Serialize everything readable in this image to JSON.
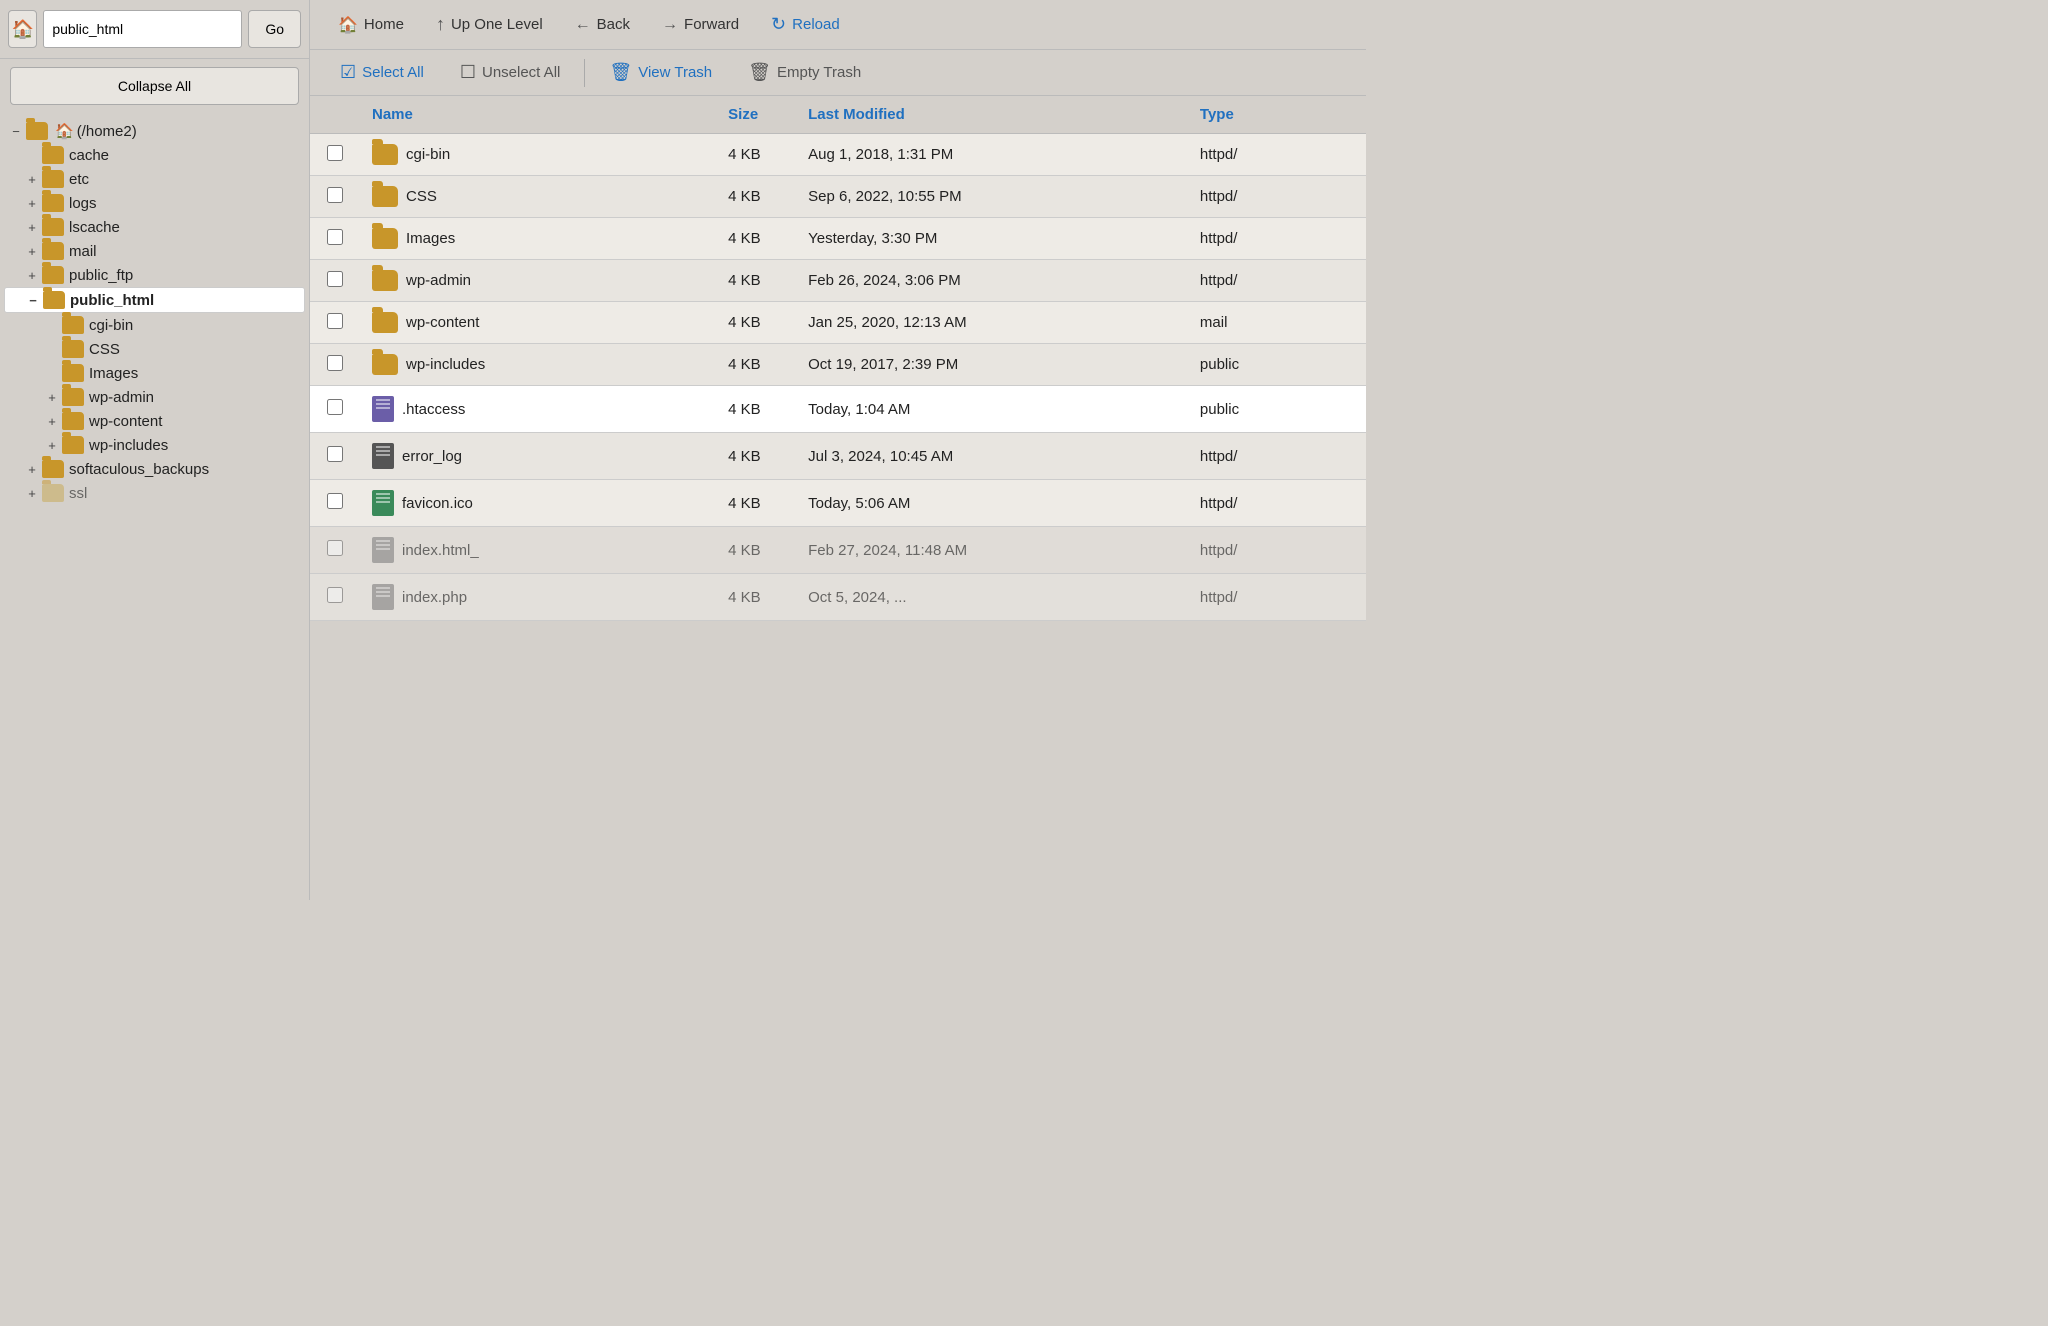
{
  "sidebar": {
    "path_value": "public_html",
    "go_label": "Go",
    "collapse_all_label": "Collapse All",
    "tree": [
      {
        "id": "home2",
        "label": "(/home2)",
        "indent": 0,
        "toggle": "−",
        "type": "home-folder",
        "selected": false
      },
      {
        "id": "cache",
        "label": "cache",
        "indent": 1,
        "toggle": "",
        "type": "folder",
        "selected": false
      },
      {
        "id": "etc",
        "label": "etc",
        "indent": 1,
        "toggle": "+",
        "type": "folder",
        "selected": false
      },
      {
        "id": "logs",
        "label": "logs",
        "indent": 1,
        "toggle": "+",
        "type": "folder",
        "selected": false
      },
      {
        "id": "lscache",
        "label": "lscache",
        "indent": 1,
        "toggle": "+",
        "type": "folder",
        "selected": false
      },
      {
        "id": "mail",
        "label": "mail",
        "indent": 1,
        "toggle": "+",
        "type": "folder",
        "selected": false
      },
      {
        "id": "public_ftp",
        "label": "public_ftp",
        "indent": 1,
        "toggle": "+",
        "type": "folder",
        "selected": false
      },
      {
        "id": "public_html",
        "label": "public_html",
        "indent": 1,
        "toggle": "−",
        "type": "folder",
        "selected": true
      },
      {
        "id": "cgi-bin-sub",
        "label": "cgi-bin",
        "indent": 2,
        "toggle": "",
        "type": "folder",
        "selected": false
      },
      {
        "id": "css-sub",
        "label": "CSS",
        "indent": 2,
        "toggle": "",
        "type": "folder",
        "selected": false
      },
      {
        "id": "images-sub",
        "label": "Images",
        "indent": 2,
        "toggle": "",
        "type": "folder",
        "selected": false
      },
      {
        "id": "wp-admin-sub",
        "label": "wp-admin",
        "indent": 2,
        "toggle": "+",
        "type": "folder",
        "selected": false
      },
      {
        "id": "wp-content-sub",
        "label": "wp-content",
        "indent": 2,
        "toggle": "+",
        "type": "folder",
        "selected": false
      },
      {
        "id": "wp-includes-sub",
        "label": "wp-includes",
        "indent": 2,
        "toggle": "+",
        "type": "folder",
        "selected": false
      },
      {
        "id": "softaculous_backups",
        "label": "softaculous_backups",
        "indent": 1,
        "toggle": "+",
        "type": "folder",
        "selected": false
      },
      {
        "id": "ssl",
        "label": "ssl",
        "indent": 1,
        "toggle": "+",
        "type": "folder-faded",
        "selected": false
      }
    ]
  },
  "toolbar": {
    "home_label": "Home",
    "up_one_level_label": "Up One Level",
    "back_label": "Back",
    "forward_label": "Forward",
    "reload_label": "Reload",
    "select_all_label": "Select All",
    "unselect_all_label": "Unselect All",
    "view_trash_label": "View Trash",
    "empty_trash_label": "Empty Trash"
  },
  "table": {
    "columns": [
      "",
      "Name",
      "Size",
      "Last Modified",
      "Type"
    ],
    "rows": [
      {
        "id": "cgi-bin",
        "name": "cgi-bin",
        "size": "4 KB",
        "modified": "Aug 1, 2018, 1:31 PM",
        "type": "httpd/",
        "icon": "folder",
        "highlighted": false,
        "checked": false
      },
      {
        "id": "css",
        "name": "CSS",
        "size": "4 KB",
        "modified": "Sep 6, 2022, 10:55 PM",
        "type": "httpd/",
        "icon": "folder",
        "highlighted": false,
        "checked": false
      },
      {
        "id": "images",
        "name": "Images",
        "size": "4 KB",
        "modified": "Yesterday, 3:30 PM",
        "type": "httpd/",
        "icon": "folder",
        "highlighted": false,
        "checked": false
      },
      {
        "id": "wp-admin",
        "name": "wp-admin",
        "size": "4 KB",
        "modified": "Feb 26, 2024, 3:06 PM",
        "type": "httpd/",
        "icon": "folder",
        "highlighted": false,
        "checked": false
      },
      {
        "id": "wp-content",
        "name": "wp-content",
        "size": "4 KB",
        "modified": "Jan 25, 2020, 12:13 AM",
        "type": "mail",
        "icon": "folder",
        "highlighted": false,
        "checked": false
      },
      {
        "id": "wp-includes",
        "name": "wp-includes",
        "size": "4 KB",
        "modified": "Oct 19, 2017, 2:39 PM",
        "type": "public",
        "icon": "folder",
        "highlighted": false,
        "checked": false
      },
      {
        "id": "htaccess",
        "name": ".htaccess",
        "size": "4 KB",
        "modified": "Today, 1:04 AM",
        "type": "public",
        "icon": "doc-purple",
        "highlighted": true,
        "checked": false
      },
      {
        "id": "error_log",
        "name": "error_log",
        "size": "4 KB",
        "modified": "Jul 3, 2024, 10:45 AM",
        "type": "httpd/",
        "icon": "doc-dark",
        "highlighted": false,
        "checked": false
      },
      {
        "id": "favicon",
        "name": "favicon.ico",
        "size": "4 KB",
        "modified": "Today, 5:06 AM",
        "type": "httpd/",
        "icon": "doc-green",
        "highlighted": false,
        "checked": false
      },
      {
        "id": "index-html",
        "name": "index.html_",
        "size": "4 KB",
        "modified": "Feb 27, 2024, 11:48 AM",
        "type": "httpd/",
        "icon": "doc-light",
        "highlighted": false,
        "checked": false,
        "dimmed": true
      },
      {
        "id": "index-php",
        "name": "index.php",
        "size": "4 KB",
        "modified": "Oct 5, 2024, ...",
        "type": "httpd/",
        "icon": "doc-light",
        "highlighted": false,
        "checked": false,
        "dimmed": true
      }
    ]
  },
  "icons": {
    "home": "🏠",
    "up_arrow": "↑",
    "back_arrow": "←",
    "forward_arrow": "→",
    "reload": "↻",
    "checkbox_checked": "☑",
    "checkbox_unchecked": "☐",
    "trash": "🗑"
  },
  "colors": {
    "accent_blue": "#2070c0",
    "folder_gold": "#c8962a",
    "background": "#d4d0cb",
    "row_light": "#eeebe6",
    "row_dark": "#e8e5e0",
    "row_highlighted": "#ffffff"
  }
}
